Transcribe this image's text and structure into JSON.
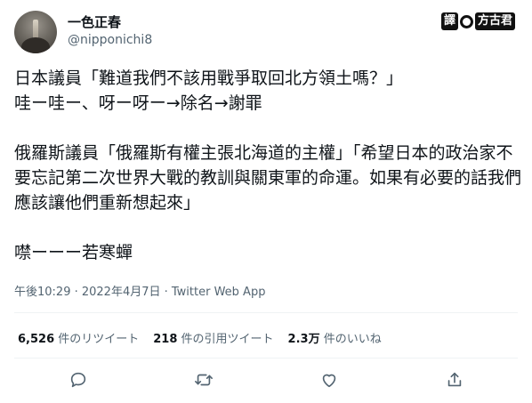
{
  "author": {
    "display_name": "一色正春",
    "handle": "@nipponichi8"
  },
  "watermark": {
    "badge": "譯",
    "name": "方古君"
  },
  "tweet": {
    "paragraphs": [
      "日本議員「難道我們不該用戰爭取回北方領土嗎？」\n哇ー哇ー、呀ー呀ー→除名→謝罪",
      "俄羅斯議員「俄羅斯有權主張北海道的主權」「希望日本的政治家不要忘記第二次世界大戰的教訓與關東軍的命運。如果有必要的話我們應該讓他們重新想起來」",
      "噤ーーー若寒蟬"
    ]
  },
  "meta": {
    "timestamp": "午後10:29 · 2022年4月7日 · Twitter Web App"
  },
  "stats": [
    {
      "count": "6,526",
      "label": " 件のリツイート"
    },
    {
      "count": "218",
      "label": " 件の引用ツイート"
    },
    {
      "count": "2.3万",
      "label": " 件のいいね"
    }
  ],
  "actions": {
    "reply": "reply-icon",
    "retweet": "retweet-icon",
    "like": "heart-icon",
    "share": "share-icon"
  },
  "colors": {
    "text": "#0f1419",
    "secondary": "#536471",
    "divider": "#eff3f4"
  }
}
